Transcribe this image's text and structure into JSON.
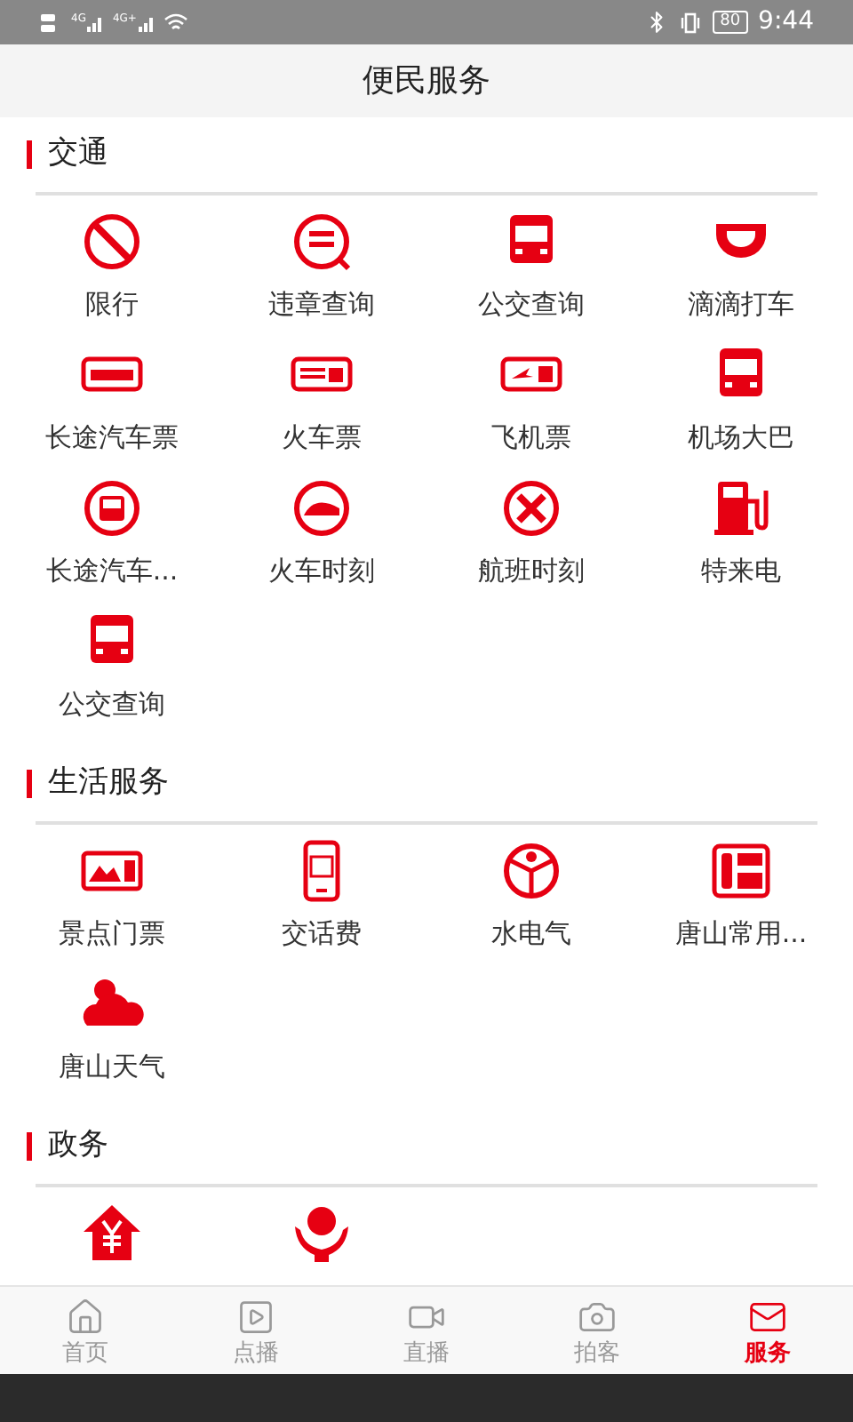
{
  "status_bar": {
    "networks": [
      "4G",
      "4G+"
    ],
    "battery": "80",
    "time": "9:44"
  },
  "header": {
    "title": "便民服务"
  },
  "sections": [
    {
      "title": "交通",
      "items": [
        {
          "label": "限行"
        },
        {
          "label": "违章查询"
        },
        {
          "label": "公交查询"
        },
        {
          "label": "滴滴打车"
        },
        {
          "label": "长途汽车票"
        },
        {
          "label": "火车票"
        },
        {
          "label": "飞机票"
        },
        {
          "label": "机场大巴"
        },
        {
          "label": "长途汽车..."
        },
        {
          "label": "火车时刻"
        },
        {
          "label": "航班时刻"
        },
        {
          "label": "特来电"
        },
        {
          "label": "公交查询"
        }
      ]
    },
    {
      "title": "生活服务",
      "items": [
        {
          "label": "景点门票"
        },
        {
          "label": "交话费"
        },
        {
          "label": "水电气"
        },
        {
          "label": "唐山常用..."
        },
        {
          "label": "唐山天气"
        }
      ]
    },
    {
      "title": "政务",
      "items": [
        {
          "kind": "icon"
        },
        {
          "kind": "icon"
        }
      ]
    }
  ],
  "bottom_nav": [
    {
      "label": "首页",
      "selected": false
    },
    {
      "label": "点播",
      "selected": false
    },
    {
      "label": "直播",
      "selected": false
    },
    {
      "label": "拍客",
      "selected": false
    },
    {
      "label": "服务",
      "selected": true
    }
  ]
}
